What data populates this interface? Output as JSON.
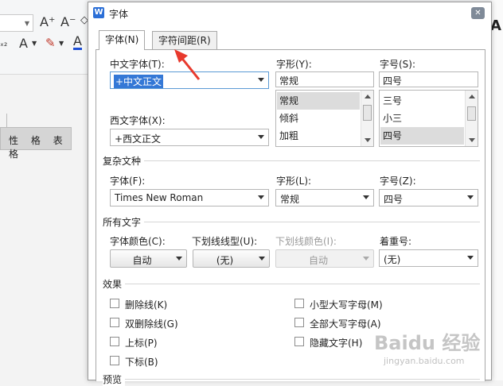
{
  "background": {
    "table_cell_text": "性 格 表 格",
    "toolbar_glyphs": {
      "grow_font": "A⁺",
      "shrink_font": "A⁻",
      "subscript": "ₓ₂",
      "text_effect": "A",
      "highlight": "✎",
      "font_color": "A",
      "right_glyph": "A"
    }
  },
  "dialog": {
    "title": "字体",
    "tabs": [
      {
        "label": "字体(N)"
      },
      {
        "label": "字符间距(R)"
      }
    ],
    "chinese_font": {
      "label": "中文字体(T):",
      "value": "+中文正文"
    },
    "western_font": {
      "label": "西文字体(X):",
      "value": "+西文正文"
    },
    "style": {
      "label": "字形(Y):",
      "value": "常规",
      "options": [
        "常规",
        "倾斜",
        "加粗"
      ],
      "selected": "常规"
    },
    "size": {
      "label": "字号(S):",
      "value": "四号",
      "options": [
        "三号",
        "小三",
        "四号"
      ],
      "selected": "四号"
    },
    "complex_script": {
      "title": "复杂文种",
      "font_label": "字体(F):",
      "font_value": "Times New Roman",
      "style_label": "字形(L):",
      "style_value": "常规",
      "size_label": "字号(Z):",
      "size_value": "四号"
    },
    "all_text": {
      "title": "所有文字",
      "color_label": "字体颜色(C):",
      "color_value": "自动",
      "underline_label": "下划线线型(U):",
      "underline_value": "(无)",
      "underline_color_label": "下划线颜色(I):",
      "underline_color_value": "自动",
      "emphasis_label": "着重号:",
      "emphasis_value": "(无)"
    },
    "effects": {
      "title": "效果",
      "left": [
        {
          "label": "删除线(K)",
          "checked": false
        },
        {
          "label": "双删除线(G)",
          "checked": false
        },
        {
          "label": "上标(P)",
          "checked": false
        },
        {
          "label": "下标(B)",
          "checked": false
        }
      ],
      "right": [
        {
          "label": "小型大写字母(M)",
          "checked": false
        },
        {
          "label": "全部大写字母(A)",
          "checked": false
        },
        {
          "label": "隐藏文字(H)",
          "checked": false
        }
      ]
    },
    "preview": {
      "title": "预览"
    }
  },
  "watermark": {
    "brand": "Baidu 经验",
    "sub": "jingyan.baidu.com"
  },
  "colors": {
    "accent": "#3478d6",
    "annotation": "#e8392d",
    "close_button": "#7f8a98"
  }
}
